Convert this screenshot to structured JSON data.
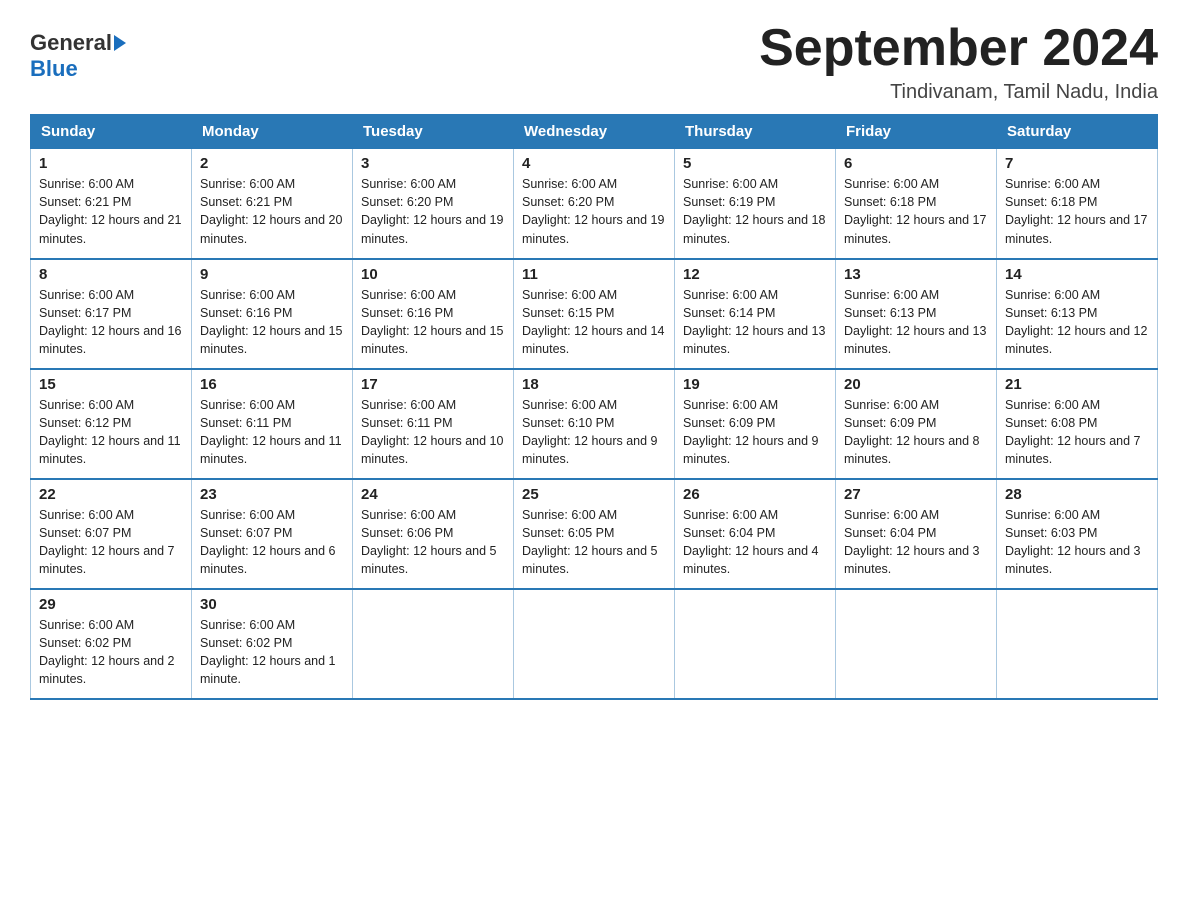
{
  "logo": {
    "general": "General",
    "blue": "Blue"
  },
  "title": "September 2024",
  "location": "Tindivanam, Tamil Nadu, India",
  "days_of_week": [
    "Sunday",
    "Monday",
    "Tuesday",
    "Wednesday",
    "Thursday",
    "Friday",
    "Saturday"
  ],
  "weeks": [
    [
      {
        "day": "1",
        "sunrise": "Sunrise: 6:00 AM",
        "sunset": "Sunset: 6:21 PM",
        "daylight": "Daylight: 12 hours and 21 minutes."
      },
      {
        "day": "2",
        "sunrise": "Sunrise: 6:00 AM",
        "sunset": "Sunset: 6:21 PM",
        "daylight": "Daylight: 12 hours and 20 minutes."
      },
      {
        "day": "3",
        "sunrise": "Sunrise: 6:00 AM",
        "sunset": "Sunset: 6:20 PM",
        "daylight": "Daylight: 12 hours and 19 minutes."
      },
      {
        "day": "4",
        "sunrise": "Sunrise: 6:00 AM",
        "sunset": "Sunset: 6:20 PM",
        "daylight": "Daylight: 12 hours and 19 minutes."
      },
      {
        "day": "5",
        "sunrise": "Sunrise: 6:00 AM",
        "sunset": "Sunset: 6:19 PM",
        "daylight": "Daylight: 12 hours and 18 minutes."
      },
      {
        "day": "6",
        "sunrise": "Sunrise: 6:00 AM",
        "sunset": "Sunset: 6:18 PM",
        "daylight": "Daylight: 12 hours and 17 minutes."
      },
      {
        "day": "7",
        "sunrise": "Sunrise: 6:00 AM",
        "sunset": "Sunset: 6:18 PM",
        "daylight": "Daylight: 12 hours and 17 minutes."
      }
    ],
    [
      {
        "day": "8",
        "sunrise": "Sunrise: 6:00 AM",
        "sunset": "Sunset: 6:17 PM",
        "daylight": "Daylight: 12 hours and 16 minutes."
      },
      {
        "day": "9",
        "sunrise": "Sunrise: 6:00 AM",
        "sunset": "Sunset: 6:16 PM",
        "daylight": "Daylight: 12 hours and 15 minutes."
      },
      {
        "day": "10",
        "sunrise": "Sunrise: 6:00 AM",
        "sunset": "Sunset: 6:16 PM",
        "daylight": "Daylight: 12 hours and 15 minutes."
      },
      {
        "day": "11",
        "sunrise": "Sunrise: 6:00 AM",
        "sunset": "Sunset: 6:15 PM",
        "daylight": "Daylight: 12 hours and 14 minutes."
      },
      {
        "day": "12",
        "sunrise": "Sunrise: 6:00 AM",
        "sunset": "Sunset: 6:14 PM",
        "daylight": "Daylight: 12 hours and 13 minutes."
      },
      {
        "day": "13",
        "sunrise": "Sunrise: 6:00 AM",
        "sunset": "Sunset: 6:13 PM",
        "daylight": "Daylight: 12 hours and 13 minutes."
      },
      {
        "day": "14",
        "sunrise": "Sunrise: 6:00 AM",
        "sunset": "Sunset: 6:13 PM",
        "daylight": "Daylight: 12 hours and 12 minutes."
      }
    ],
    [
      {
        "day": "15",
        "sunrise": "Sunrise: 6:00 AM",
        "sunset": "Sunset: 6:12 PM",
        "daylight": "Daylight: 12 hours and 11 minutes."
      },
      {
        "day": "16",
        "sunrise": "Sunrise: 6:00 AM",
        "sunset": "Sunset: 6:11 PM",
        "daylight": "Daylight: 12 hours and 11 minutes."
      },
      {
        "day": "17",
        "sunrise": "Sunrise: 6:00 AM",
        "sunset": "Sunset: 6:11 PM",
        "daylight": "Daylight: 12 hours and 10 minutes."
      },
      {
        "day": "18",
        "sunrise": "Sunrise: 6:00 AM",
        "sunset": "Sunset: 6:10 PM",
        "daylight": "Daylight: 12 hours and 9 minutes."
      },
      {
        "day": "19",
        "sunrise": "Sunrise: 6:00 AM",
        "sunset": "Sunset: 6:09 PM",
        "daylight": "Daylight: 12 hours and 9 minutes."
      },
      {
        "day": "20",
        "sunrise": "Sunrise: 6:00 AM",
        "sunset": "Sunset: 6:09 PM",
        "daylight": "Daylight: 12 hours and 8 minutes."
      },
      {
        "day": "21",
        "sunrise": "Sunrise: 6:00 AM",
        "sunset": "Sunset: 6:08 PM",
        "daylight": "Daylight: 12 hours and 7 minutes."
      }
    ],
    [
      {
        "day": "22",
        "sunrise": "Sunrise: 6:00 AM",
        "sunset": "Sunset: 6:07 PM",
        "daylight": "Daylight: 12 hours and 7 minutes."
      },
      {
        "day": "23",
        "sunrise": "Sunrise: 6:00 AM",
        "sunset": "Sunset: 6:07 PM",
        "daylight": "Daylight: 12 hours and 6 minutes."
      },
      {
        "day": "24",
        "sunrise": "Sunrise: 6:00 AM",
        "sunset": "Sunset: 6:06 PM",
        "daylight": "Daylight: 12 hours and 5 minutes."
      },
      {
        "day": "25",
        "sunrise": "Sunrise: 6:00 AM",
        "sunset": "Sunset: 6:05 PM",
        "daylight": "Daylight: 12 hours and 5 minutes."
      },
      {
        "day": "26",
        "sunrise": "Sunrise: 6:00 AM",
        "sunset": "Sunset: 6:04 PM",
        "daylight": "Daylight: 12 hours and 4 minutes."
      },
      {
        "day": "27",
        "sunrise": "Sunrise: 6:00 AM",
        "sunset": "Sunset: 6:04 PM",
        "daylight": "Daylight: 12 hours and 3 minutes."
      },
      {
        "day": "28",
        "sunrise": "Sunrise: 6:00 AM",
        "sunset": "Sunset: 6:03 PM",
        "daylight": "Daylight: 12 hours and 3 minutes."
      }
    ],
    [
      {
        "day": "29",
        "sunrise": "Sunrise: 6:00 AM",
        "sunset": "Sunset: 6:02 PM",
        "daylight": "Daylight: 12 hours and 2 minutes."
      },
      {
        "day": "30",
        "sunrise": "Sunrise: 6:00 AM",
        "sunset": "Sunset: 6:02 PM",
        "daylight": "Daylight: 12 hours and 1 minute."
      },
      null,
      null,
      null,
      null,
      null
    ]
  ]
}
